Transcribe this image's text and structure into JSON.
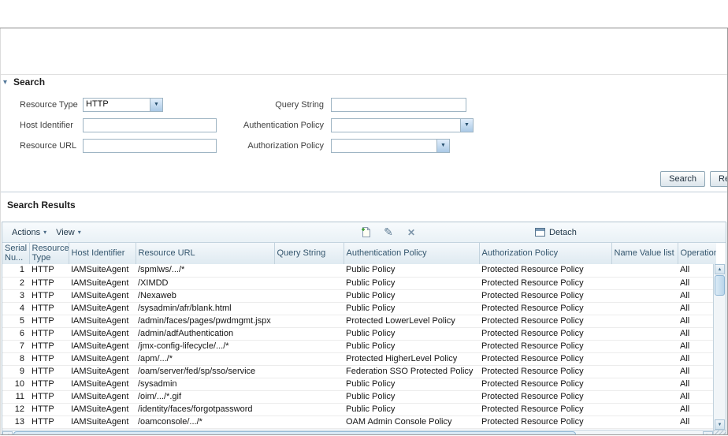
{
  "search_panel": {
    "title": "Search",
    "fields": {
      "resource_type": {
        "label": "Resource Type",
        "value": "HTTP"
      },
      "host_identifier": {
        "label": "Host Identifier",
        "value": ""
      },
      "resource_url": {
        "label": "Resource URL",
        "value": ""
      },
      "query_string": {
        "label": "Query String",
        "value": ""
      },
      "authentication_policy": {
        "label": "Authentication Policy",
        "value": ""
      },
      "authorization_policy": {
        "label": "Authorization Policy",
        "value": ""
      }
    },
    "buttons": {
      "search": "Search",
      "reset": "Reset"
    }
  },
  "results": {
    "title": "Search Results",
    "toolbar": {
      "actions": "Actions",
      "view": "View",
      "detach": "Detach"
    },
    "columns": [
      "Serial Nu...",
      "Resource Type",
      "Host Identifier",
      "Resource URL",
      "Query String",
      "Authentication Policy",
      "Authorization Policy",
      "Name Value list",
      "Operations"
    ],
    "rows": [
      {
        "serial": "1",
        "type": "HTTP",
        "host": "IAMSuiteAgent",
        "url": "/spmlws/.../*",
        "query": "",
        "authn": "Public Policy",
        "authz": "Protected Resource Policy",
        "nvl": "",
        "ops": "All"
      },
      {
        "serial": "2",
        "type": "HTTP",
        "host": "IAMSuiteAgent",
        "url": "/XIMDD",
        "query": "",
        "authn": "Public Policy",
        "authz": "Protected Resource Policy",
        "nvl": "",
        "ops": "All"
      },
      {
        "serial": "3",
        "type": "HTTP",
        "host": "IAMSuiteAgent",
        "url": "/Nexaweb",
        "query": "",
        "authn": "Public Policy",
        "authz": "Protected Resource Policy",
        "nvl": "",
        "ops": "All"
      },
      {
        "serial": "4",
        "type": "HTTP",
        "host": "IAMSuiteAgent",
        "url": "/sysadmin/afr/blank.html",
        "query": "",
        "authn": "Public Policy",
        "authz": "Protected Resource Policy",
        "nvl": "",
        "ops": "All"
      },
      {
        "serial": "5",
        "type": "HTTP",
        "host": "IAMSuiteAgent",
        "url": "/admin/faces/pages/pwdmgmt.jspx",
        "query": "",
        "authn": "Protected LowerLevel Policy",
        "authz": "Protected Resource Policy",
        "nvl": "",
        "ops": "All"
      },
      {
        "serial": "6",
        "type": "HTTP",
        "host": "IAMSuiteAgent",
        "url": "/admin/adfAuthentication",
        "query": "",
        "authn": "Public Policy",
        "authz": "Protected Resource Policy",
        "nvl": "",
        "ops": "All"
      },
      {
        "serial": "7",
        "type": "HTTP",
        "host": "IAMSuiteAgent",
        "url": "/jmx-config-lifecycle/.../*",
        "query": "",
        "authn": "Public Policy",
        "authz": "Protected Resource Policy",
        "nvl": "",
        "ops": "All"
      },
      {
        "serial": "8",
        "type": "HTTP",
        "host": "IAMSuiteAgent",
        "url": "/apm/.../*",
        "query": "",
        "authn": "Protected HigherLevel Policy",
        "authz": "Protected Resource Policy",
        "nvl": "",
        "ops": "All"
      },
      {
        "serial": "9",
        "type": "HTTP",
        "host": "IAMSuiteAgent",
        "url": "/oam/server/fed/sp/sso/service",
        "query": "",
        "authn": "Federation SSO Protected Policy",
        "authz": "Protected Resource Policy",
        "nvl": "",
        "ops": "All"
      },
      {
        "serial": "10",
        "type": "HTTP",
        "host": "IAMSuiteAgent",
        "url": "/sysadmin",
        "query": "",
        "authn": "Public Policy",
        "authz": "Protected Resource Policy",
        "nvl": "",
        "ops": "All"
      },
      {
        "serial": "11",
        "type": "HTTP",
        "host": "IAMSuiteAgent",
        "url": "/oim/.../*.gif",
        "query": "",
        "authn": "Public Policy",
        "authz": "Protected Resource Policy",
        "nvl": "",
        "ops": "All"
      },
      {
        "serial": "12",
        "type": "HTTP",
        "host": "IAMSuiteAgent",
        "url": "/identity/faces/forgotpassword",
        "query": "",
        "authn": "Public Policy",
        "authz": "Protected Resource Policy",
        "nvl": "",
        "ops": "All"
      },
      {
        "serial": "13",
        "type": "HTTP",
        "host": "IAMSuiteAgent",
        "url": "/oamconsole/.../*",
        "query": "",
        "authn": "OAM Admin Console Policy",
        "authz": "Protected Resource Policy",
        "nvl": "",
        "ops": "All"
      }
    ]
  },
  "icons": {
    "disclosure": "▾",
    "dropdown_arrow": "▼",
    "menu_caret": "▾",
    "edit": "✎",
    "delete": "✕",
    "scroll_up": "▲",
    "scroll_down": "▼",
    "scroll_left": "◄",
    "scroll_right": "►"
  },
  "colors": {
    "accent": "#3a77a8",
    "table_header_bg": "#e3edf4",
    "toolbar_bg": "#eef4f8",
    "scroll_thumb": "#bcd8ec"
  }
}
